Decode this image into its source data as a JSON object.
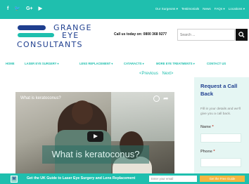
{
  "topbar": {
    "social": [
      "f",
      "🐦",
      "G+",
      "▶"
    ],
    "nav": [
      "Our Surgeons ▾",
      "Testimonials",
      "News",
      "FAQs ▾",
      "Locations ▾"
    ]
  },
  "logo": {
    "line1": "GRANGE",
    "line2": "EYE",
    "line3": "CONSULTANTS"
  },
  "header": {
    "call_us": "Call us today on: 0800 368 9277",
    "search_placeholder": "Search ..."
  },
  "mainnav": {
    "items": [
      "HOME",
      "LASER EYE SURGERY ▾",
      "LENS REPLACEMENT ▾",
      "CATARACTS ▾",
      "MORE EYE TREATMENTS ▾",
      "CONTACT US"
    ]
  },
  "pager": {
    "previous": "<Previous",
    "next": "Next>"
  },
  "video": {
    "title": "What is keratoconus?",
    "caption": "What is keratoconus?"
  },
  "sidebar": {
    "title": "Request a Call Back",
    "text": "Fill in your details and we'll give you a call back.",
    "name_label": "Name",
    "phone_label": "Phone",
    "required_mark": "*"
  },
  "bottombar": {
    "icon": "M",
    "text": "Get the UK Guide to Laser Eye Surgery and Lens Replacement",
    "email_placeholder": "Enter your email",
    "button": "Get the Free Guide"
  },
  "colors": {
    "teal": "#1fbfae",
    "navy": "#1f3f8f",
    "button": "#f4b63f"
  }
}
